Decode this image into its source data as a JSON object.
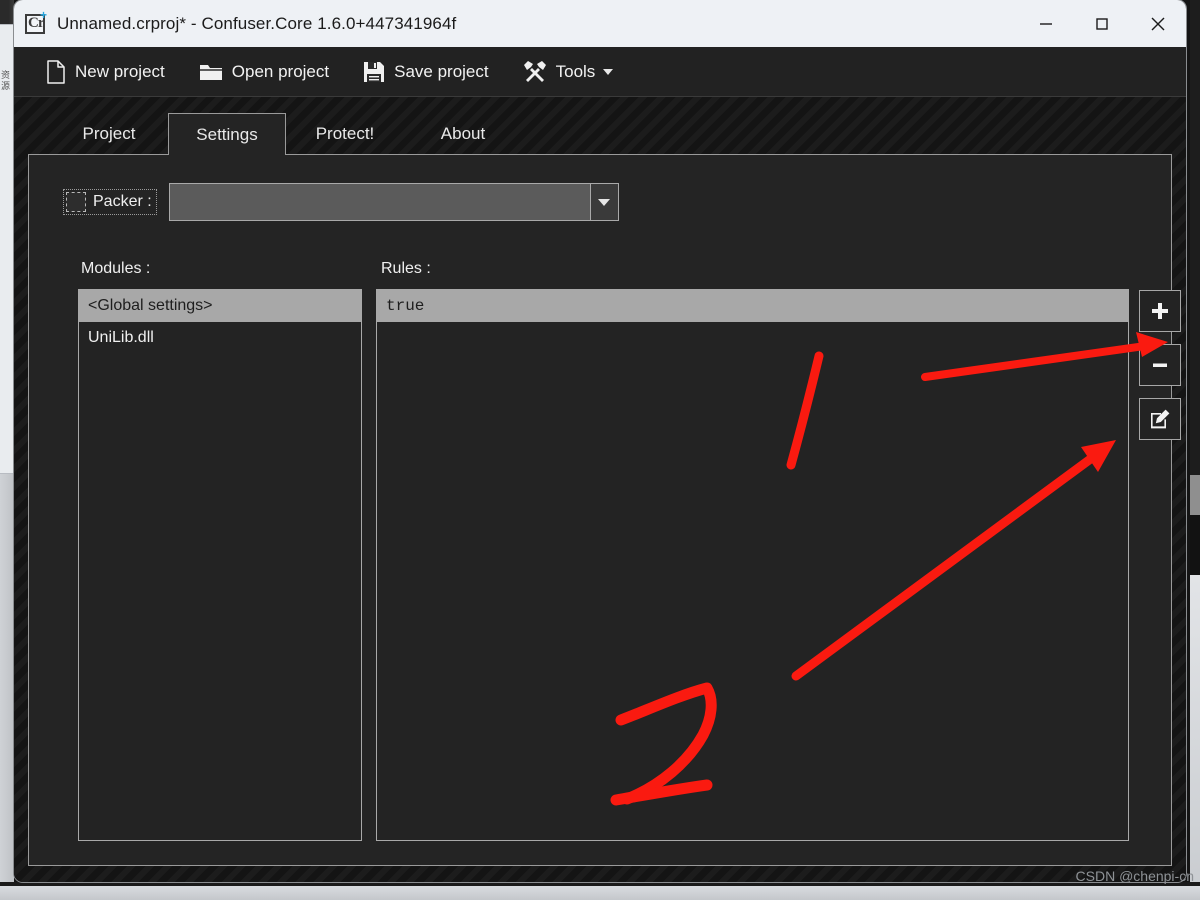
{
  "window": {
    "title": "Unnamed.crproj* - Confuser.Core 1.6.0+447341964f",
    "app_icon": "confuser-app-icon",
    "icon_letters": "Cr",
    "controls": {
      "minimize": "minimize-icon",
      "maximize": "maximize-icon",
      "close": "close-icon"
    }
  },
  "toolbar": {
    "items": [
      {
        "label": "New project",
        "icon": "new-document-icon"
      },
      {
        "label": "Open project",
        "icon": "open-folder-icon"
      },
      {
        "label": "Save project",
        "icon": "floppy-disk-icon"
      },
      {
        "label": "Tools",
        "icon": "tools-hammer-wrench-icon",
        "has_caret": true
      }
    ]
  },
  "tabs": [
    {
      "label": "Project",
      "active": false
    },
    {
      "label": "Settings",
      "active": true
    },
    {
      "label": "Protect!",
      "active": false
    },
    {
      "label": "About",
      "active": false
    }
  ],
  "settings": {
    "packer": {
      "label": "Packer :",
      "checked": false,
      "combo_value": "",
      "combo_placeholder": ""
    },
    "modules": {
      "label": "Modules :",
      "items": [
        {
          "text": "<Global settings>",
          "selected": true
        },
        {
          "text": "UniLib.dll",
          "selected": false
        }
      ]
    },
    "rules": {
      "label": "Rules :",
      "items": [
        {
          "text": "true",
          "selected": true
        }
      ]
    },
    "side_buttons": [
      {
        "name": "add-rule-button",
        "icon": "plus-icon"
      },
      {
        "name": "remove-rule-button",
        "icon": "minus-icon"
      },
      {
        "name": "edit-rule-button",
        "icon": "edit-pencil-icon"
      }
    ]
  },
  "annotations": {
    "color": "#fa1a10",
    "marks": [
      {
        "name": "stroke-one",
        "label": "1"
      },
      {
        "name": "arrow-to-add",
        "label": ""
      },
      {
        "name": "stroke-two",
        "label": "2"
      },
      {
        "name": "arrow-to-edit",
        "label": ""
      }
    ]
  },
  "watermark": {
    "text": "CSDN @chenpi-cn"
  },
  "desktop": {
    "side_label": "资源"
  }
}
